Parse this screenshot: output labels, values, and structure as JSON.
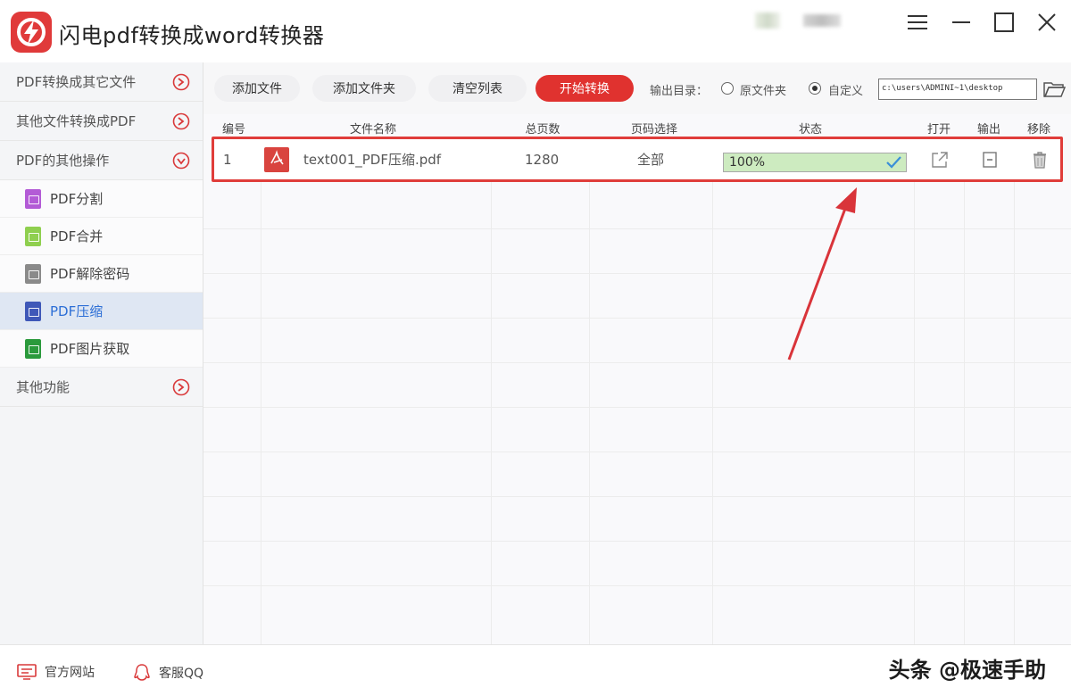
{
  "app": {
    "title": "闪电pdf转换成word转换器",
    "accent_color": "#e0322f"
  },
  "sidebar": {
    "groups": [
      {
        "label": "PDF转换成其它文件"
      },
      {
        "label": "其他文件转换成PDF"
      },
      {
        "label": "PDF的其他操作"
      },
      {
        "label": "其他功能"
      }
    ],
    "items": [
      {
        "label": "PDF分割",
        "icon": "pdf-split-icon",
        "color": "#b35bd6"
      },
      {
        "label": "PDF合并",
        "icon": "pdf-merge-icon",
        "color": "#8fcf4f"
      },
      {
        "label": "PDF解除密码",
        "icon": "pdf-unlock-icon",
        "color": "#8a8a8a"
      },
      {
        "label": "PDF压缩",
        "icon": "pdf-compress-icon",
        "color": "#3f58b8",
        "active": true
      },
      {
        "label": "PDF图片获取",
        "icon": "pdf-image-icon",
        "color": "#2b9a3c"
      }
    ]
  },
  "toolbar": {
    "add_file": "添加文件",
    "add_folder": "添加文件夹",
    "clear_list": "清空列表",
    "start": "开始转换",
    "output_dir_label": "输出目录：",
    "option_original": "原文件夹",
    "option_custom": "自定义",
    "output_path": "c:\\users\\ADMINI~1\\desktop"
  },
  "table": {
    "headers": [
      "编号",
      "文件名称",
      "总页数",
      "页码选择",
      "状态",
      "打开",
      "输出",
      "移除"
    ],
    "rows": [
      {
        "index": "1",
        "filename": "text001_PDF压缩.pdf",
        "pages": "1280",
        "page_select": "全部",
        "status": "100%",
        "progress": 1.0
      }
    ]
  },
  "bottom": {
    "website": "官方网站",
    "support": "客服QQ",
    "watermark": "头条 @极速手助"
  }
}
